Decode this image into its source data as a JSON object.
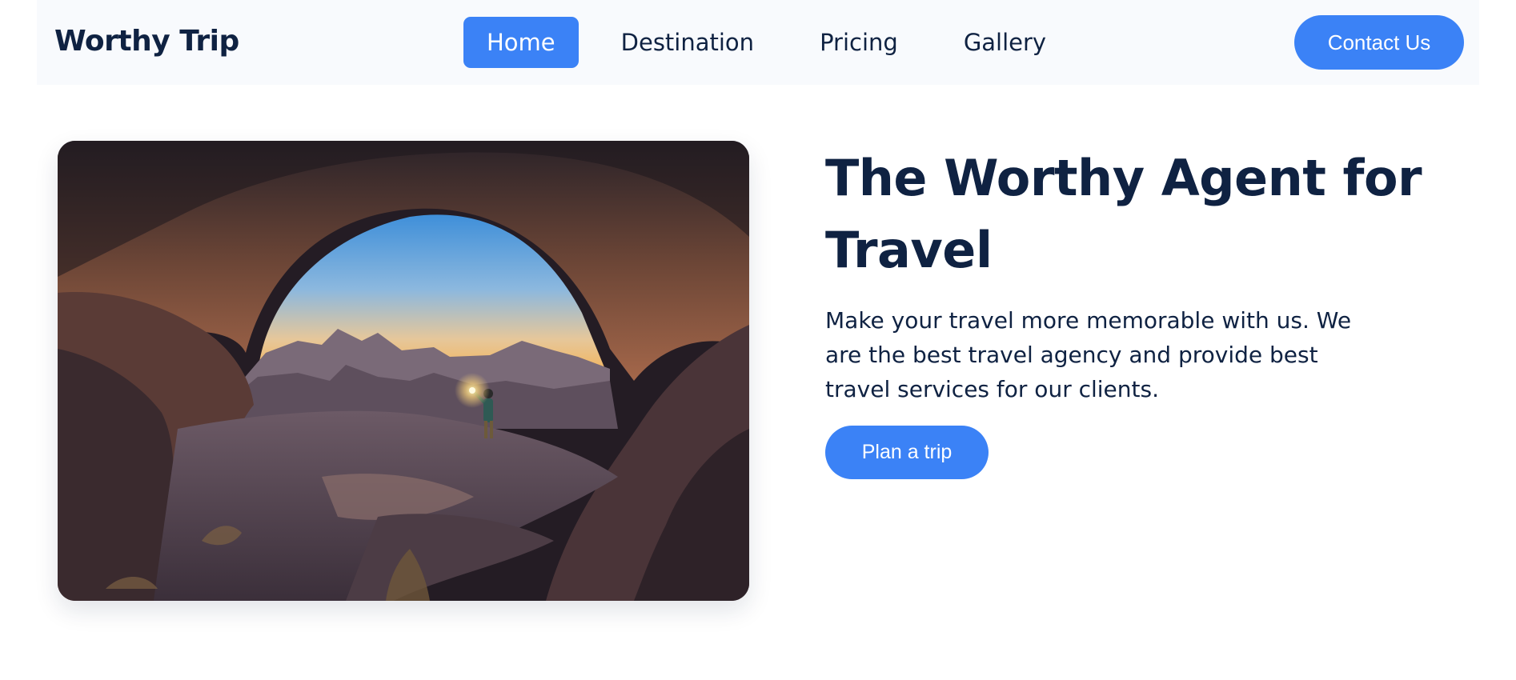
{
  "nav": {
    "brand": "Worthy Trip",
    "links": [
      {
        "label": "Home",
        "active": true
      },
      {
        "label": "Destination",
        "active": false
      },
      {
        "label": "Pricing",
        "active": false
      },
      {
        "label": "Gallery",
        "active": false
      }
    ],
    "contact_label": "Contact Us"
  },
  "hero": {
    "image_icon": "desert-rock-arch-photo",
    "title": "The Worthy Agent for Travel",
    "description": "Make your travel more memorable with us. We are the best travel agency and provide best travel services for our clients.",
    "cta_label": "Plan a trip"
  },
  "colors": {
    "accent": "#3b82f6",
    "text_dark": "#0f2242",
    "navbar_bg": "#f8fafd"
  }
}
